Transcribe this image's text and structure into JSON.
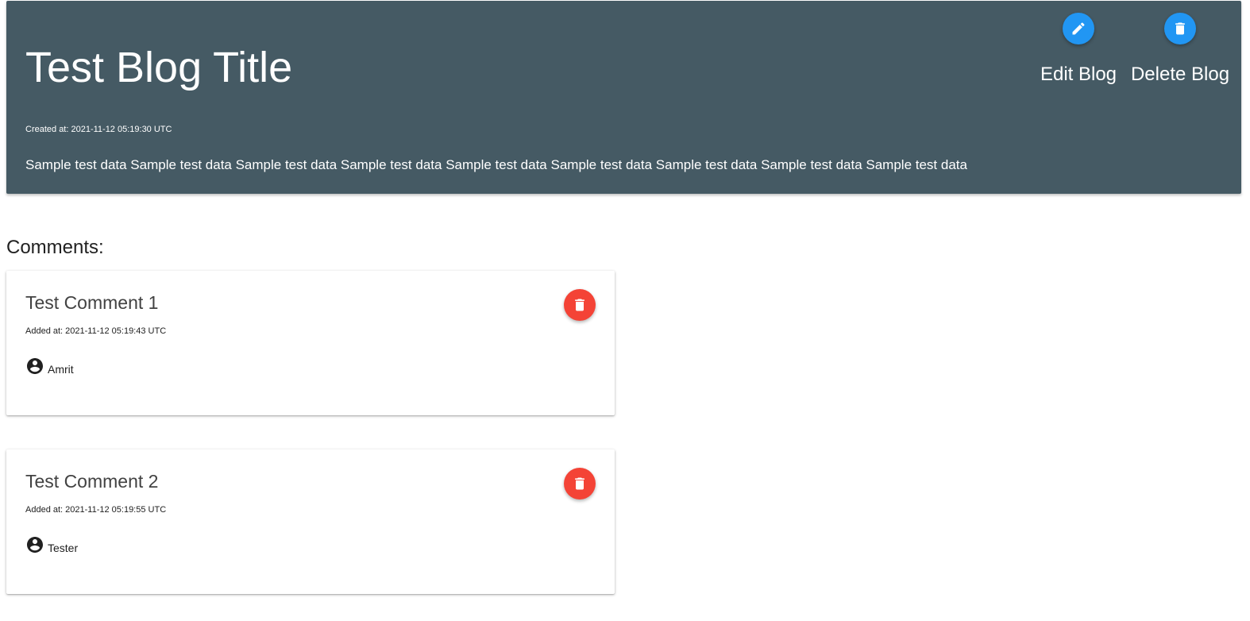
{
  "blog": {
    "title": "Test Blog Title",
    "created": "Created at: 2021-11-12 05:19:30 UTC",
    "body": "Sample test data Sample test data Sample test data Sample test data Sample test data Sample test data Sample test data Sample test data Sample test data",
    "edit_label": "Edit Blog",
    "delete_label": "Delete Blog",
    "edit_icon": "pencil-icon",
    "delete_icon": "trash-icon"
  },
  "comments": {
    "heading": "Comments:",
    "items": [
      {
        "title": "Test Comment 1",
        "added": "Added at: 2021-11-12 05:19:43 UTC",
        "author": "Amrit"
      },
      {
        "title": "Test Comment 2",
        "added": "Added at: 2021-11-12 05:19:55 UTC",
        "author": "Tester"
      }
    ]
  },
  "colors": {
    "header_bg": "#455a64",
    "primary": "#2196f3",
    "danger": "#f44336"
  }
}
